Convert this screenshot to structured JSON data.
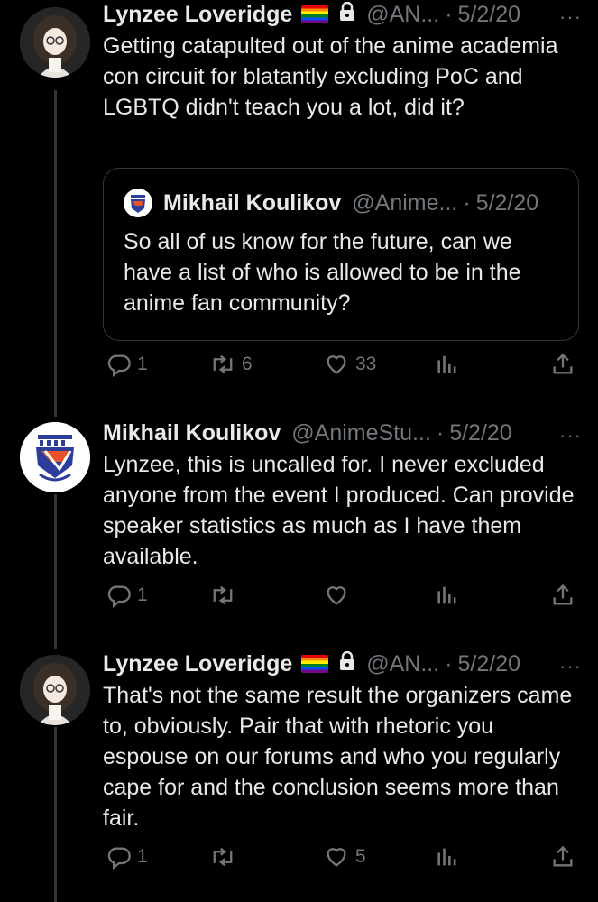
{
  "tweets": [
    {
      "name": "Lynzee Loveridge",
      "handle": "@AN...",
      "date": "5/2/20",
      "text": "Getting catapulted out of the anime academia con circuit for blatantly excluding PoC and LGBTQ didn't teach you a lot, did it?",
      "replies": "1",
      "retweets": "6",
      "likes": "33",
      "quote": {
        "name": "Mikhail Koulikov",
        "handle": "@Anime...",
        "date": "5/2/20",
        "text": "So all of us know for the future, can we have a list of who is allowed to be in the anime fan community?"
      }
    },
    {
      "name": "Mikhail Koulikov",
      "handle": "@AnimeStu...",
      "date": "5/2/20",
      "text": "Lynzee, this is uncalled for. I never excluded anyone from the event I produced. Can provide speaker statistics as much as I have them available.",
      "replies": "1",
      "retweets": "",
      "likes": ""
    },
    {
      "name": "Lynzee Loveridge",
      "handle": "@AN...",
      "date": "5/2/20",
      "text": "That's not the same result the organizers came to, obviously. Pair that with rhetoric you espouse on our forums and who you regularly cape for and the conclusion seems more than fair.",
      "replies": "1",
      "retweets": "",
      "likes": "5"
    }
  ],
  "separator": "·",
  "more_glyph": "···",
  "colors": {
    "background": "#000000",
    "text": "#e7e9ea",
    "muted": "#71767b",
    "border": "#333639"
  },
  "icons": [
    "reply-icon",
    "retweet-icon",
    "like-icon",
    "views-icon",
    "share-icon",
    "lock-icon",
    "rainbow-flag-icon",
    "more-icon"
  ]
}
